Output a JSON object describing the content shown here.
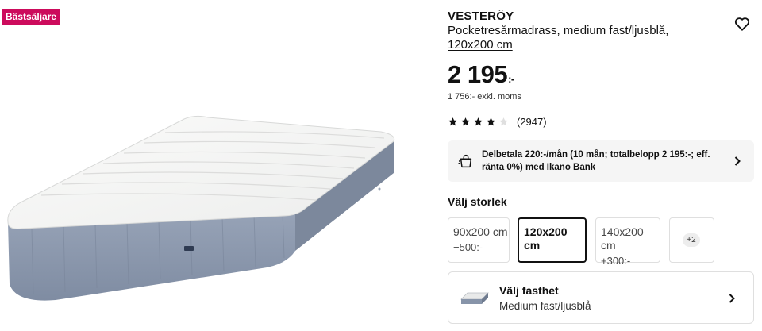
{
  "badge": {
    "label": "Bästsäljare",
    "color": "#cc0b5c"
  },
  "product": {
    "brand": "VESTERÖY",
    "description": "Pocketresårmadrass, medium fast/ljusblå,",
    "size_link": "120x200 cm",
    "wishlist_icon": "heart-icon",
    "image_alt": "mattress"
  },
  "price": {
    "amount": "2 195",
    "suffix": ":-",
    "excl_vat": "1 756:- exkl. moms"
  },
  "rating": {
    "stars": 4,
    "max_stars": 5,
    "count": "(2947)"
  },
  "finance": {
    "icon": "shopping-bag-icon",
    "text": "Delbetala 220:-/mån (10 mån; totalbelopp 2 195:-; eff. ränta 0%) med Ikano Bank"
  },
  "size_selector": {
    "heading": "Välj storlek",
    "options": [
      {
        "label": "90x200 cm",
        "delta": "−500:-",
        "selected": false
      },
      {
        "label": "120x200 cm",
        "delta": "",
        "selected": true
      },
      {
        "label": "140x200 cm",
        "delta": "+300:-",
        "selected": false
      }
    ],
    "more": "+2"
  },
  "firmness": {
    "title": "Välj fasthet",
    "value": "Medium fast/ljusblå",
    "icon": "mattress-icon"
  },
  "colors": {
    "mattress_top": "#f6f6f4",
    "mattress_side": "#8e9bb0",
    "badge": "#cc0b5c"
  }
}
